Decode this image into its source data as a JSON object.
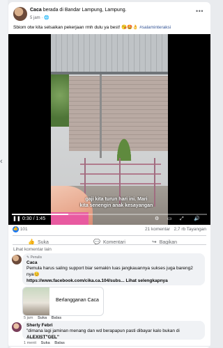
{
  "post": {
    "author": "Caca",
    "location_text": "berada di Bandar Lampung, Lampung.",
    "time": "5 jam",
    "privacy_icon": "globe-icon",
    "caption": "Sbiom otw kita selsaikan pekerjaan rmh dulu ya best! 😘🤩👌",
    "hashtag": "#salaminteraksi",
    "more_icon": "•••"
  },
  "video": {
    "subtitle_line1": "gaji kita turun hari ini. Mari",
    "subtitle_line2": "kita senengin anak kesayangan",
    "time": "0:30 / 1:45",
    "progress": 0.29
  },
  "stats": {
    "reactions": "101",
    "comments": "21 komentar",
    "views": "2,7 rb Tayangan"
  },
  "actions": {
    "like": "Suka",
    "comment": "Komentari",
    "share": "Bagikan"
  },
  "comments_section": {
    "more_label": "Lihat komentar lain",
    "comment1": {
      "badge": "Penulis",
      "name": "Caca",
      "text1": "Pemula harus saling support biar semakin luas jangkauannya sukses juga bareng2",
      "text2": "nya😊",
      "link": "https://www.facebook.com/cika.ca.104/subs... Lihat selengkapnya",
      "subscribe_label": "Berlangganan Caca",
      "time": "5 jam",
      "like": "Suka",
      "reply": "Balas"
    },
    "comment2": {
      "name": "Sherly Febri",
      "text1": "\"dimana lagi jaminan menang dan wd berapapun pasti dibayar kalo bukan di",
      "text2": "A̲L̲E̲X̲I̲S̲T̲\"G̲E̲L̲\"",
      "time": "1 menit",
      "like": "Suka",
      "reply": "Balas"
    }
  },
  "colors": {
    "accent": "#1877f2",
    "link": "#385898",
    "muted": "#65676b",
    "bubble": "#f0f2f5"
  }
}
